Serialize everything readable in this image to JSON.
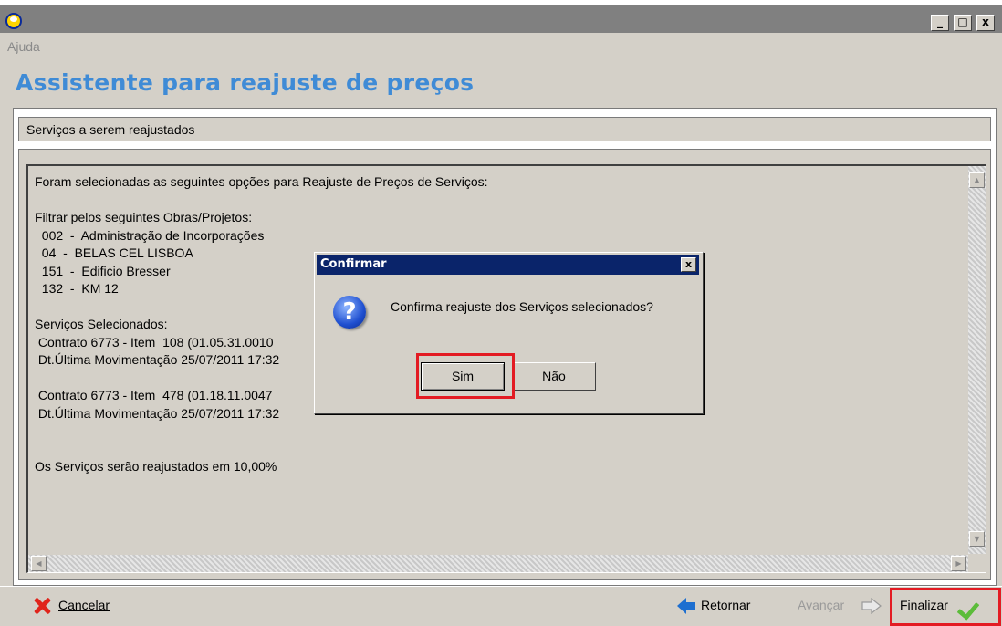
{
  "window": {
    "minimize": "_",
    "maximize": "□",
    "close": "x"
  },
  "menu": {
    "help_label": "Ajuda"
  },
  "page": {
    "title": "Assistente para reajuste de preços"
  },
  "section": {
    "header": "Serviços a serem reajustados"
  },
  "summary": {
    "lines": [
      "Foram selecionadas as seguintes opções para Reajuste de Preços de Serviços:",
      "",
      "Filtrar pelos seguintes Obras/Projetos:",
      "  002  -  Administração de Incorporações",
      "  04  -  BELAS CEL LISBOA",
      "  151  -  Edificio Bresser",
      "  132  -  KM 12",
      "",
      "Serviços Selecionados:",
      " Contrato 6773 - Item  108 (01.05.31.0010",
      " Dt.Última Movimentação 25/07/2011 17:32",
      "",
      " Contrato 6773 - Item  478 (01.18.11.0047",
      " Dt.Última Movimentação 25/07/2011 17:32",
      "",
      "",
      "Os Serviços serão reajustados em 10,00%"
    ]
  },
  "dialog": {
    "title": "Confirmar",
    "message": "Confirma reajuste dos Serviços selecionados?",
    "question_glyph": "?",
    "close_glyph": "x",
    "yes_label": "Sim",
    "no_label": "Não"
  },
  "footer": {
    "cancel_label": "Cancelar",
    "back_label": "Retornar",
    "next_label": "Avançar",
    "finish_label": "Finalizar"
  },
  "colors": {
    "title_blue": "#3f8bd6",
    "highlight_red": "#e31b23",
    "dialog_titlebar": "#0a246a"
  }
}
